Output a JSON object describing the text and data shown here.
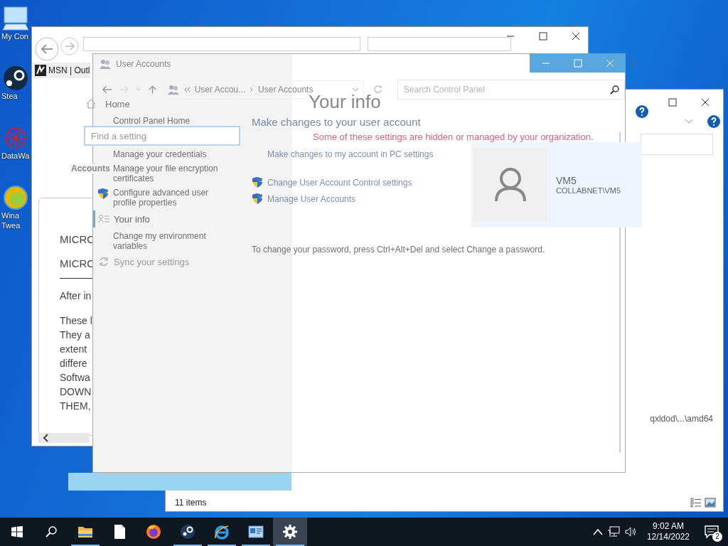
{
  "desktop_icons": [
    {
      "kind": "computer",
      "lines": [
        "My Con"
      ]
    },
    {
      "kind": "steam",
      "lines": [
        "Stea"
      ]
    },
    {
      "kind": "datawarp",
      "lines": [
        "DataWa"
      ]
    },
    {
      "kind": "winaero",
      "lines": [
        "Wina",
        "Twea"
      ]
    }
  ],
  "browser": {
    "tab": "MSN | Outl",
    "lines": [
      {
        "text": "MICRO",
        "kind": "heading"
      },
      {
        "text": "MICRO",
        "kind": "heading"
      },
      {
        "text": "After in",
        "kind": "intro"
      },
      {
        "text": "These l",
        "kind": "body"
      },
      {
        "text": "They a",
        "kind": "body"
      },
      {
        "text": "extent",
        "kind": "body"
      },
      {
        "text": "differe",
        "kind": "body"
      },
      {
        "text": "Softwa",
        "kind": "body"
      },
      {
        "text": "DOWN",
        "kind": "body"
      },
      {
        "text": "THEM,",
        "kind": "body"
      }
    ]
  },
  "explorer": {
    "path_fragment": "qxldod\\...\\amd64",
    "status": "11 items"
  },
  "control_panel": {
    "title": "User Accounts",
    "breadcrumb": [
      "User Accou...",
      "User Accounts"
    ],
    "search_placeholder": "Search Control Panel",
    "sidebar": [
      {
        "label": "Control Panel Home",
        "kind": "plain"
      },
      {
        "label": "Manage your credentials",
        "kind": "plain"
      },
      {
        "label": "Manage your file encryption certificates",
        "kind": "plain"
      },
      {
        "label": "Configure advanced user profile properties",
        "kind": "shield"
      },
      {
        "label": "Change my environment variables",
        "kind": "plain"
      }
    ],
    "heading": "Make changes to your user account",
    "links": [
      {
        "label": "Make changes to my account in PC settings",
        "kind": "plain"
      },
      {
        "label": "Change User Account Control settings",
        "kind": "shield"
      },
      {
        "label": "Manage User Accounts",
        "kind": "shield"
      }
    ],
    "note": "To change your password, press Ctrl+Alt+Del and select Change a password."
  },
  "settings": {
    "search_placeholder": "Find a setting",
    "home": "Home",
    "section": "Accounts",
    "nav": [
      {
        "label": "Your info",
        "kind": "person",
        "selected": true
      },
      {
        "label": "Sync your settings",
        "kind": "sync",
        "selected": false
      }
    ],
    "title": "Your info",
    "notice": "Some of these settings are hidden or managed by your organization.",
    "user": {
      "name": "VM5",
      "account": "COLLABNET\\VM5"
    }
  },
  "taskbar": {
    "apps": [
      {
        "kind": "folder",
        "running": true,
        "selected": false
      },
      {
        "kind": "file",
        "running": false,
        "selected": false
      },
      {
        "kind": "firefox",
        "running": false,
        "selected": false
      },
      {
        "kind": "steam",
        "running": true,
        "selected": false
      },
      {
        "kind": "ie",
        "running": true,
        "selected": false
      },
      {
        "kind": "control",
        "running": true,
        "selected": false
      },
      {
        "kind": "gear",
        "running": true,
        "selected": true
      }
    ],
    "time": "9:02 AM",
    "date": "12/14/2022",
    "notifications": "2"
  }
}
